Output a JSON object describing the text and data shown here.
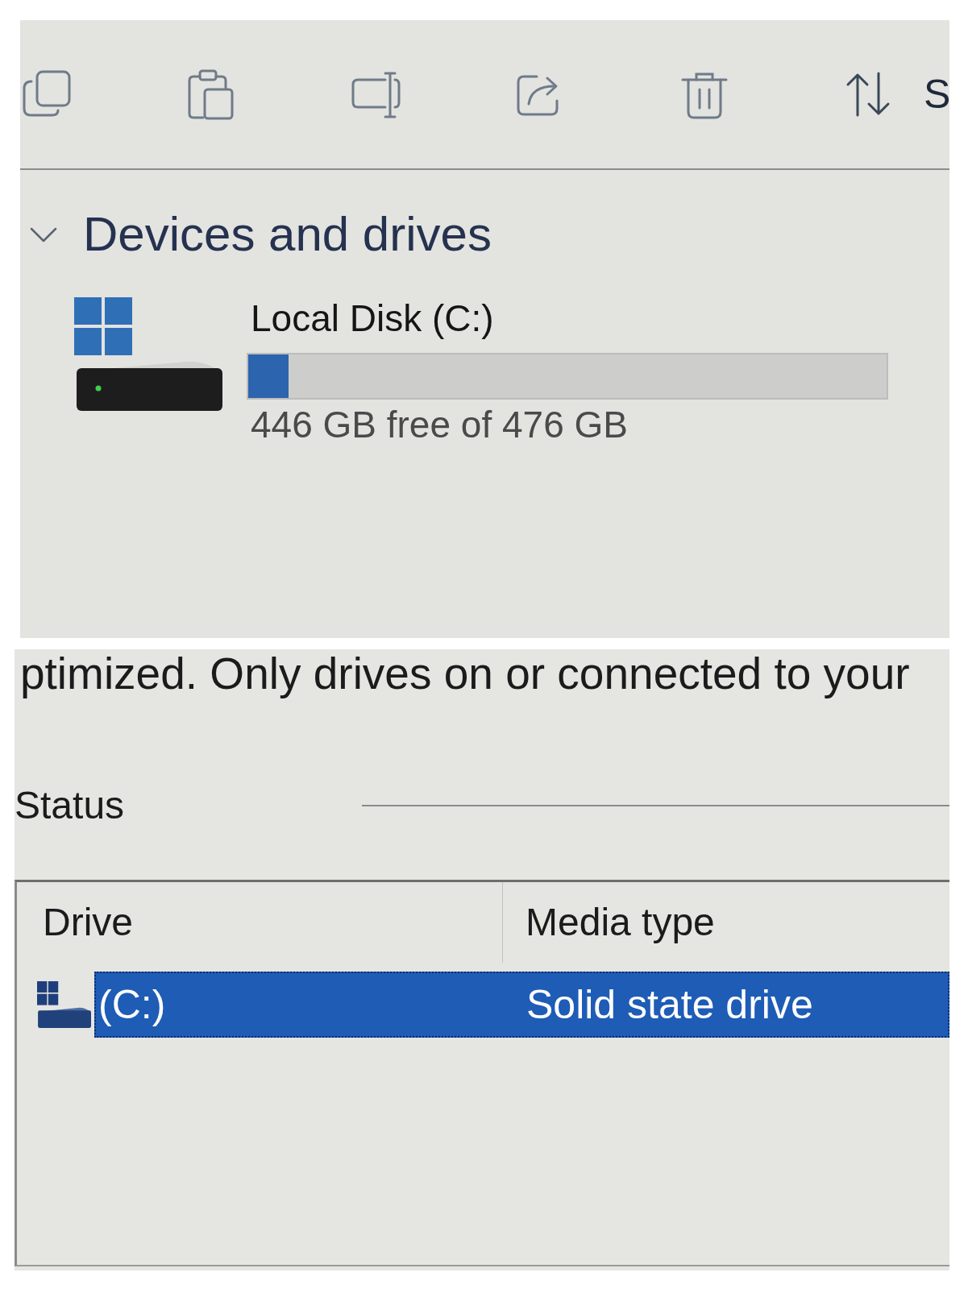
{
  "toolbar": {
    "sort_label": "S"
  },
  "devices": {
    "title": "Devices and drives",
    "expanded": true,
    "drives": [
      {
        "name": "Local Disk (C:)",
        "level": 0.063,
        "space": "446 GB free of 476 GB"
      }
    ]
  },
  "optimize": {
    "description": "ptimized. Only drives on or connected to your",
    "status_label": "Status",
    "table": {
      "columns": [
        "Drive",
        "Media type"
      ],
      "rows": [
        {
          "drive": "(C:)",
          "media_type": "Solid state drive",
          "selected": true
        }
      ]
    }
  }
}
